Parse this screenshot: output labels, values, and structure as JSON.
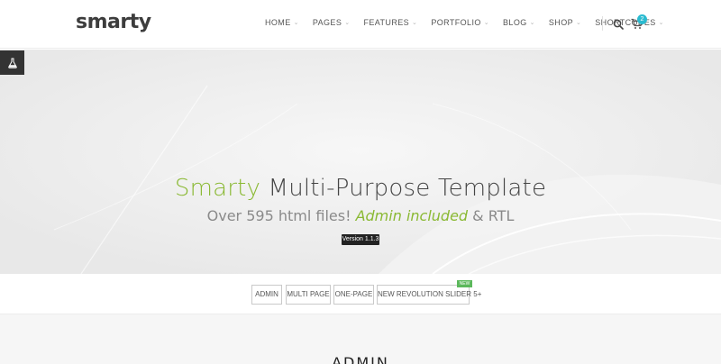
{
  "header": {
    "logo": "smarty",
    "nav": [
      {
        "label": "HOME"
      },
      {
        "label": "PAGES"
      },
      {
        "label": "FEATURES"
      },
      {
        "label": "PORTFOLIO"
      },
      {
        "label": "BLOG"
      },
      {
        "label": "SHOP"
      },
      {
        "label": "SHORTCODES"
      }
    ],
    "cart_count": "2",
    "icons": [
      "search-icon",
      "cart-icon",
      "chevron-down-icon"
    ]
  },
  "side_tool": {
    "icon": "flask-icon"
  },
  "hero": {
    "title_accent": "Smarty",
    "title_rest": " Multi-Purpose Template",
    "subtitle_pre": "Over 595 html files! ",
    "subtitle_accent": "Admin included",
    "subtitle_post": " & RTL",
    "version": "Version 1.1.3"
  },
  "demo_buttons": [
    {
      "label": "ADMIN"
    },
    {
      "label": "MULTI PAGE"
    },
    {
      "label": "ONE-PAGE"
    },
    {
      "label": "NEW REVOLUTION SLIDER 5+"
    }
  ],
  "new_badge": "NEW",
  "section": {
    "title": "ADMIN"
  },
  "colors": {
    "accent_green": "#8ab933",
    "badge_blue": "#2bbbd0",
    "new_green": "#5cb85c"
  }
}
